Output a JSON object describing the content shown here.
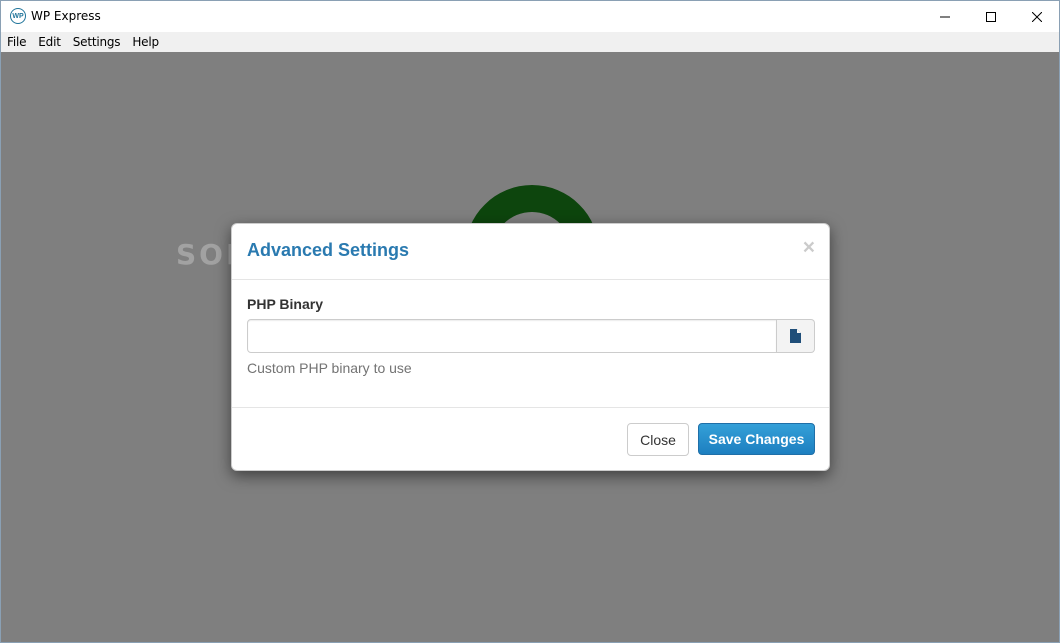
{
  "window": {
    "title": "WP Express",
    "app_icon_text": "WP"
  },
  "menu": {
    "items": [
      "File",
      "Edit",
      "Settings",
      "Help"
    ]
  },
  "watermark": {
    "text": "SOFTPEDIA"
  },
  "modal": {
    "title": "Advanced Settings",
    "close_glyph": "×",
    "php_binary": {
      "label": "PHP Binary",
      "value": "",
      "help_text": "Custom PHP binary to use",
      "browse_icon": "file-icon"
    },
    "buttons": {
      "close_label": "Close",
      "save_label": "Save Changes"
    }
  },
  "colors": {
    "title_accent": "#2a7ab0",
    "primary_button": "#1d7fc0",
    "spinner": "#1a8a1a",
    "overlay": "rgba(0,0,0,0.5)"
  }
}
